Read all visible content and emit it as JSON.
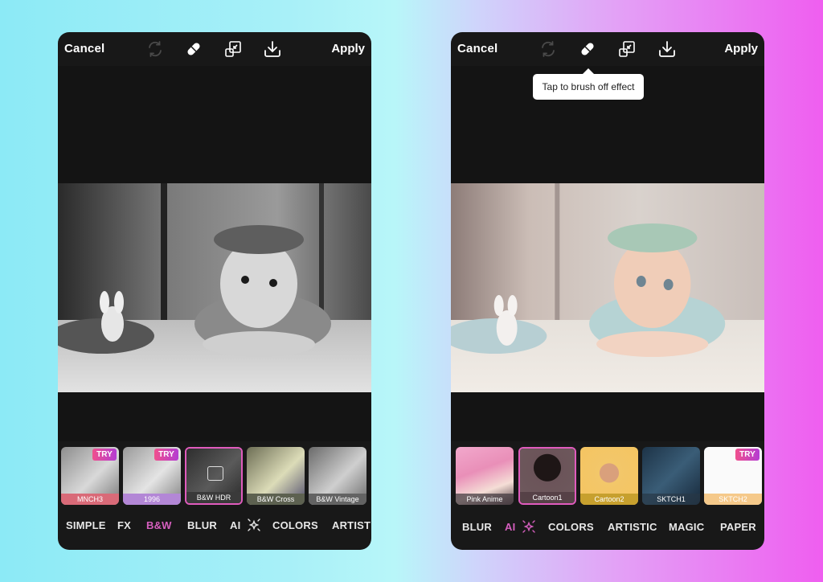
{
  "colors": {
    "accent": "#d65fbf",
    "panel_bg": "#181818",
    "try_badge_from": "#f0508d",
    "try_badge_to": "#b43cd3"
  },
  "left_panel": {
    "toolbar": {
      "cancel_label": "Cancel",
      "apply_label": "Apply",
      "icons": [
        "refresh-icon",
        "eraser-icon",
        "compare-icon",
        "download-icon"
      ]
    },
    "thumbnails": [
      {
        "label": "MNCH3",
        "try": "TRY",
        "label_color": "#d96a78",
        "selected": false
      },
      {
        "label": "1996",
        "try": "TRY",
        "label_color": "#b387d6",
        "selected": false
      },
      {
        "label": "B&W HDR",
        "try": null,
        "label_color": "#3a3a3a",
        "selected": true
      },
      {
        "label": "B&W Cross",
        "try": null,
        "label_color": "#5d6150",
        "selected": false
      },
      {
        "label": "B&W Vintage",
        "try": null,
        "label_color": "#636363",
        "selected": false
      }
    ],
    "tabs": [
      {
        "label": "SIMPLE",
        "active": false
      },
      {
        "label": "FX",
        "active": false
      },
      {
        "label": "B&W",
        "active": true
      },
      {
        "label": "BLUR",
        "active": false
      },
      {
        "label": "AI",
        "active": false
      },
      {
        "label": "COLORS",
        "active": false
      },
      {
        "label": "ARTISTIC",
        "active": false
      }
    ]
  },
  "right_panel": {
    "toolbar": {
      "cancel_label": "Cancel",
      "apply_label": "Apply",
      "icons": [
        "refresh-icon",
        "eraser-icon",
        "compare-icon",
        "download-icon"
      ]
    },
    "tooltip": "Tap to brush off effect",
    "thumbnails": [
      {
        "label": "Pink Anime",
        "try": null,
        "label_color": "#5b4a55",
        "selected": false
      },
      {
        "label": "Cartoon1",
        "try": null,
        "label_color": "#5a4149",
        "selected": true
      },
      {
        "label": "Cartoon2",
        "try": null,
        "label_color": "#c7a02e",
        "selected": false
      },
      {
        "label": "SKTCH1",
        "try": null,
        "label_color": "#3f4f61",
        "selected": false
      },
      {
        "label": "SKTCH2",
        "try": "TRY",
        "label_color": "#f5c98a",
        "selected": false
      }
    ],
    "tabs": [
      {
        "label": "BLUR",
        "active": false
      },
      {
        "label": "AI",
        "active": true
      },
      {
        "label": "COLORS",
        "active": false
      },
      {
        "label": "ARTISTIC",
        "active": false
      },
      {
        "label": "MAGIC",
        "active": false
      },
      {
        "label": "PAPER",
        "active": false
      }
    ]
  }
}
